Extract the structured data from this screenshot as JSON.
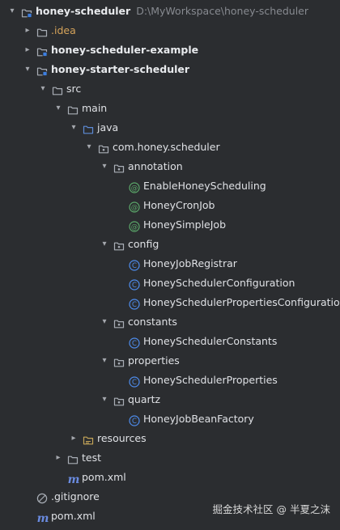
{
  "tree": [
    {
      "depth": 0,
      "arrow": "▾",
      "icon": "module-folder-icon",
      "label": "honey-scheduler",
      "path": "D:\\MyWorkspace\\honey-scheduler",
      "bold": true
    },
    {
      "depth": 1,
      "arrow": "▸",
      "icon": "folder-icon",
      "label": ".idea",
      "idea": true
    },
    {
      "depth": 1,
      "arrow": "▸",
      "icon": "module-folder-icon",
      "label": "honey-scheduler-example",
      "bold": true
    },
    {
      "depth": 1,
      "arrow": "▾",
      "icon": "module-folder-icon",
      "label": "honey-starter-scheduler",
      "bold": true
    },
    {
      "depth": 2,
      "arrow": "▾",
      "icon": "folder-icon",
      "label": "src"
    },
    {
      "depth": 3,
      "arrow": "▾",
      "icon": "folder-icon",
      "label": "main"
    },
    {
      "depth": 4,
      "arrow": "▾",
      "icon": "source-folder-icon",
      "label": "java"
    },
    {
      "depth": 5,
      "arrow": "▾",
      "icon": "package-icon",
      "label": "com.honey.scheduler"
    },
    {
      "depth": 6,
      "arrow": "▾",
      "icon": "package-icon",
      "label": "annotation"
    },
    {
      "depth": 7,
      "arrow": "",
      "icon": "annotation-icon",
      "label": "EnableHoneyScheduling"
    },
    {
      "depth": 7,
      "arrow": "",
      "icon": "annotation-icon",
      "label": "HoneyCronJob"
    },
    {
      "depth": 7,
      "arrow": "",
      "icon": "annotation-icon",
      "label": "HoneySimpleJob"
    },
    {
      "depth": 6,
      "arrow": "▾",
      "icon": "package-icon",
      "label": "config"
    },
    {
      "depth": 7,
      "arrow": "",
      "icon": "class-icon",
      "label": "HoneyJobRegistrar"
    },
    {
      "depth": 7,
      "arrow": "",
      "icon": "class-icon",
      "label": "HoneySchedulerConfiguration"
    },
    {
      "depth": 7,
      "arrow": "",
      "icon": "class-icon",
      "label": "HoneySchedulerPropertiesConfiguration"
    },
    {
      "depth": 6,
      "arrow": "▾",
      "icon": "package-icon",
      "label": "constants"
    },
    {
      "depth": 7,
      "arrow": "",
      "icon": "class-icon",
      "label": "HoneySchedulerConstants"
    },
    {
      "depth": 6,
      "arrow": "▾",
      "icon": "package-icon",
      "label": "properties"
    },
    {
      "depth": 7,
      "arrow": "",
      "icon": "class-icon",
      "label": "HoneySchedulerProperties"
    },
    {
      "depth": 6,
      "arrow": "▾",
      "icon": "package-icon",
      "label": "quartz"
    },
    {
      "depth": 7,
      "arrow": "",
      "icon": "class-icon",
      "label": "HoneyJobBeanFactory"
    },
    {
      "depth": 4,
      "arrow": "▸",
      "icon": "resources-folder-icon",
      "label": "resources"
    },
    {
      "depth": 3,
      "arrow": "▸",
      "icon": "folder-icon",
      "label": "test"
    },
    {
      "depth": 3,
      "arrow": "",
      "icon": "maven-icon",
      "label": "pom.xml"
    },
    {
      "depth": 1,
      "arrow": "",
      "icon": "gitignore-icon",
      "label": ".gitignore"
    },
    {
      "depth": 1,
      "arrow": "",
      "icon": "maven-icon",
      "label": "pom.xml"
    }
  ],
  "watermark": "掘金技术社区 @ 半夏之沫",
  "colors": {
    "background": "#2b2d30",
    "text": "#dfe1e5",
    "folder": "#a9aeb6",
    "source_folder": "#5d8bd6",
    "resources_folder": "#c3a458",
    "module_mark": "#3d7fe0",
    "class_icon": "#4e8cec",
    "annotation_icon": "#5ba86a",
    "maven": "#6a8be0"
  }
}
